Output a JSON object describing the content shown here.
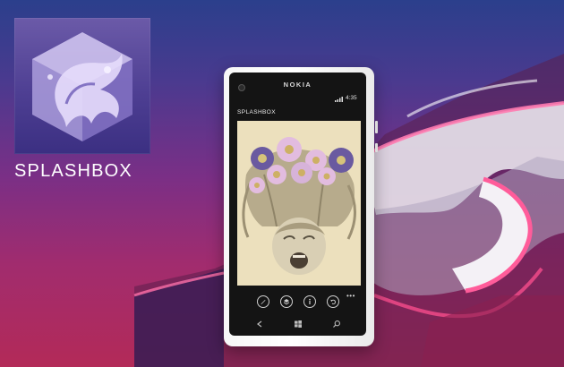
{
  "app": {
    "name": "SPLASHBOX"
  },
  "phone": {
    "brand": "NOKIA",
    "status_time": "4:35",
    "screen_title": "SPLASHBOX"
  },
  "icons": {
    "logo": "splash-cube-icon",
    "app_bar": [
      "edit-icon",
      "layers-icon",
      "info-icon",
      "undo-icon"
    ],
    "more": "more-dots-icon",
    "nav": [
      "back-icon",
      "windows-start-icon",
      "search-icon"
    ],
    "status": "signal-icon"
  },
  "colors": {
    "background_top": "#2b3f8c",
    "background_bottom": "#b32a58",
    "logo_tile": "#4e3f93",
    "phone_shell": "#ffffff",
    "photo_tone": "#ece0bd",
    "flower_pink": "#e2bcdf",
    "flower_purple": "#6a5aa0"
  }
}
